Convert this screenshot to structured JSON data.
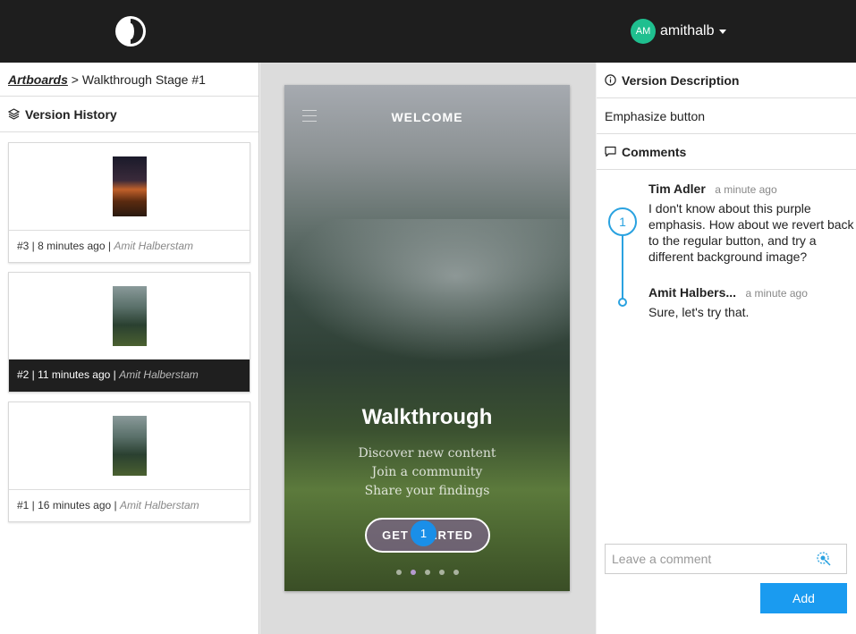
{
  "header": {
    "user_initials": "AM",
    "username": "amithalb"
  },
  "left_panel": {
    "breadcrumb": {
      "link": "Artboards",
      "separator": ">",
      "current": "Walkthrough Stage #1"
    },
    "version_history_title": "Version History",
    "versions": [
      {
        "label": "#3 | 8 minutes ago |",
        "author": "Amit Halberstam",
        "thumbnail": "dark-sunset"
      },
      {
        "label": "#2 | 11 minutes ago |",
        "author": "Amit Halberstam",
        "thumbnail": "forest",
        "selected": true
      },
      {
        "label": "#1 | 16 minutes ago |",
        "author": "Amit Halberstam",
        "thumbnail": "forest"
      }
    ]
  },
  "artboard": {
    "title": "WELCOME",
    "heading": "Walkthrough",
    "lines": [
      "Discover new content",
      "Join a community",
      "Share your findings"
    ],
    "button_label": "GET STARTED",
    "pin_number": "1",
    "page_count": 5,
    "active_page": 2
  },
  "right_panel": {
    "description_title": "Version Description",
    "description": "Emphasize button",
    "comments_title": "Comments",
    "thread_number": "1",
    "comments": [
      {
        "author": "Tim Adler",
        "time": "a minute ago",
        "text": "I don't know about this purple emphasis. How about we revert back to the regular button, and try a different background image?"
      },
      {
        "author": "Amit Halbers...",
        "time": "a minute ago",
        "text": "Sure, let's try that."
      }
    ],
    "comment_placeholder": "Leave a comment",
    "add_label": "Add"
  },
  "colors": {
    "accent": "#1a9bf0",
    "avatar": "#1fbf8f",
    "topbar": "#1e1e1e"
  }
}
